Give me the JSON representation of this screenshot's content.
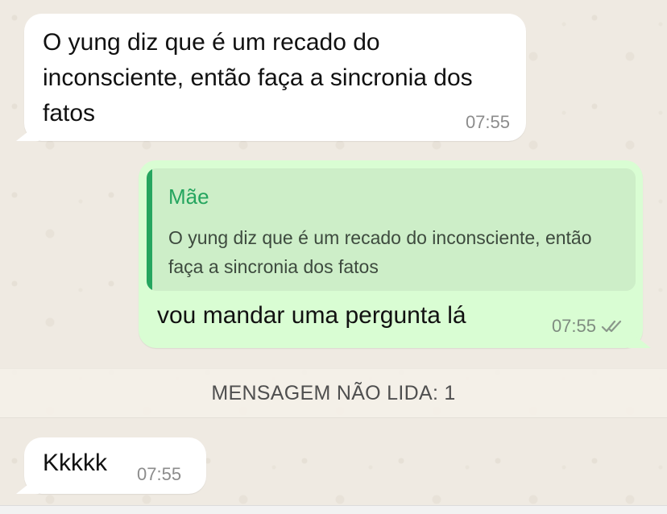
{
  "messages": {
    "incoming_1": {
      "text": "O yung diz que é um recado do inconsciente, então faça a sincronia dos fatos",
      "time": "07:55"
    },
    "outgoing_1": {
      "quote_author": "Mãe",
      "quote_text": "O yung diz que é um recado do inconsciente, então faça a sincronia dos fatos",
      "text": "vou mandar uma pergunta lá",
      "time": "07:55",
      "status_icon": "double-check-icon"
    },
    "incoming_2": {
      "text": "Kkkkk",
      "time": "07:55"
    }
  },
  "unread_divider": {
    "label": "MENSAGEM NÃO LIDA: 1"
  },
  "colors": {
    "chat_background": "#efeae2",
    "incoming_bubble": "#ffffff",
    "outgoing_bubble": "#d9fdd3",
    "quote_background": "#cdeec8",
    "quote_accent": "#25a55f"
  }
}
